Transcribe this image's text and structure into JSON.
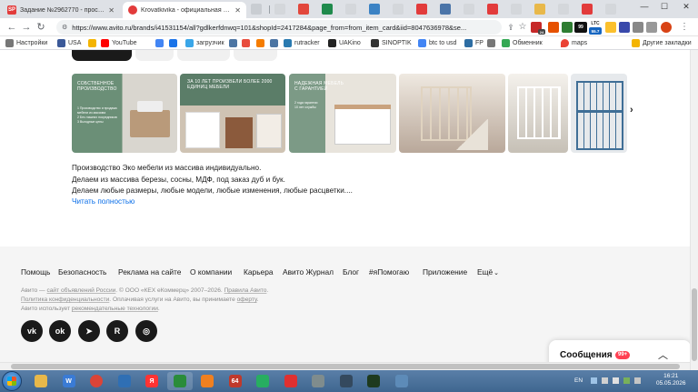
{
  "browser": {
    "tabs": [
      {
        "favicon": "SP",
        "title": "Задание №2962770 - просмотр з",
        "active": false
      },
      {
        "favicon": "A",
        "title": "Krovatkivika - официальная стра",
        "active": true
      }
    ],
    "url": "https://www.avito.ru/brands/i41531154/all?gdlkerfdnwq=101&shopId=2417284&page_from=from_item_card&iid=8047636978&se...",
    "ext_badges": {
      "red": "24",
      "ltc": "LTC",
      "ltc_price": "55.7",
      "cpu": "99"
    }
  },
  "bookmarks": [
    {
      "label": "Настройки",
      "icon_color": "#777777"
    },
    {
      "label": "USA",
      "icon_color": "#3b5998"
    },
    {
      "label": "",
      "icon_color": "#f4b400"
    },
    {
      "label": "YouTube",
      "icon_color": "#ff0000"
    },
    {
      "label": "",
      "icon_color": "#4285f4"
    },
    {
      "label": "",
      "icon_color": "#1a73e8"
    },
    {
      "label": "загрузчик",
      "icon_color": "#3aa6e8"
    },
    {
      "label": "",
      "icon_color": "#4c75a3"
    },
    {
      "label": "",
      "icon_color": "#e84c3d"
    },
    {
      "label": "",
      "icon_color": "#f57c00"
    },
    {
      "label": "",
      "icon_color": "#4c75a3"
    },
    {
      "label": "rutracker",
      "icon_color": "#2a7ab0"
    },
    {
      "label": "UAKino",
      "icon_color": "#222222"
    },
    {
      "label": "SINOPTIK",
      "icon_color": "#333333"
    },
    {
      "label": "btc to usd",
      "icon_color": "#4285f4"
    },
    {
      "label": "FP",
      "icon_color": "#2d6da3"
    },
    {
      "label": "",
      "icon_color": "#777777"
    },
    {
      "label": "Обменник",
      "icon_color": "#34a853"
    },
    {
      "label": "maps",
      "icon_color": "#ea4335"
    },
    {
      "label": "Другие закладки",
      "icon_color": "#f4b400"
    }
  ],
  "banners": [
    {
      "caption": "Собственное производство",
      "sub": "1 Производство и продажа мебели из массива\n2 Без лишних посредников\n3 Выгодные цены",
      "bg1": "#6b8f77",
      "bg2": "#d9d6cf",
      "dark": false
    },
    {
      "caption": "За 10 лет произвели более 2000 единиц мебели",
      "sub": "",
      "bg1": "#5b7d68",
      "bg2": "#cfc3b3",
      "dark": false
    },
    {
      "caption": "Надежная мебель с гарантией",
      "sub": "2 года гарантии\n10 лет службы",
      "bg1": "#7c9a86",
      "bg2": "#e8e4dc",
      "dark": false
    },
    {
      "caption": "",
      "sub": "",
      "bg1": "#b9a89a",
      "bg2": "#efe9e1",
      "dark": true
    },
    {
      "caption": "",
      "sub": "",
      "bg1": "#c6c0b6",
      "bg2": "#f4f1ec",
      "dark": true
    },
    {
      "caption": "",
      "sub": "",
      "bg1": "#3f6e96",
      "bg2": "#e6e9ec",
      "dark": true
    }
  ],
  "description": {
    "line1": "Производство Эко мебели из массива индивидуально.",
    "line2": "Делаем из массива березы, сосны, МДФ, под заказ дуб и бук.",
    "line3": "Делаем любые размеры, любые модели, любые изменения, любые расцветки....",
    "read_more": "Читать полностью"
  },
  "footer": {
    "links": [
      "Помощь",
      "Безопасность",
      "Реклама на сайте",
      "О компании",
      "Карьера",
      "Авито Журнал",
      "Блог",
      "#яПомогаю",
      "Приложение",
      "Ещё"
    ],
    "line1_a": "Авито — ",
    "line1_b": "сайт объявлений России",
    "line1_c": ". © ООО «КЕХ еКоммерц» 2007–2026. ",
    "line1_d": "Правила Авито",
    "line1_e": ".",
    "line2_a": "Политика конфиденциальности",
    "line2_b": ". Оплачивая услуги на Авито, вы принимаете ",
    "line2_c": "оферту",
    "line2_d": ".",
    "line3_a": "Авито использует ",
    "line3_b": "рекомендательные технологии",
    "line3_c": ".",
    "social": [
      "vk",
      "ok",
      "telegram",
      "rutube",
      "dzen"
    ]
  },
  "messages": {
    "label": "Сообщения",
    "badge": "99+"
  },
  "taskbar": {
    "apps": [
      {
        "icon": "folder",
        "color": "#e8b84a",
        "glyph": ""
      },
      {
        "icon": "wm",
        "color": "#3a7bd5",
        "glyph": "W"
      },
      {
        "icon": "chrome",
        "color": "#db4437",
        "glyph": ""
      },
      {
        "icon": "network",
        "color": "#2f6fb4",
        "glyph": ""
      },
      {
        "icon": "yandex",
        "color": "#ff3333",
        "glyph": "Я"
      },
      {
        "icon": "monitor",
        "color": "#2a8c3a",
        "glyph": ""
      },
      {
        "icon": "media",
        "color": "#f08020",
        "glyph": ""
      },
      {
        "icon": "aida",
        "color": "#c0392b",
        "glyph": "64"
      },
      {
        "icon": "charts",
        "color": "#27ae60",
        "glyph": ""
      },
      {
        "icon": "opera",
        "color": "#e03030",
        "glyph": ""
      },
      {
        "icon": "app-gray",
        "color": "#7f8c8d",
        "glyph": ""
      },
      {
        "icon": "app-dark",
        "color": "#34495e",
        "glyph": ""
      },
      {
        "icon": "cmd",
        "color": "#1e3a1e",
        "glyph": ""
      },
      {
        "icon": "window",
        "color": "#5d8bb8",
        "glyph": ""
      }
    ],
    "lang": "EN",
    "time": "16:21",
    "date": "05.05.2026"
  }
}
